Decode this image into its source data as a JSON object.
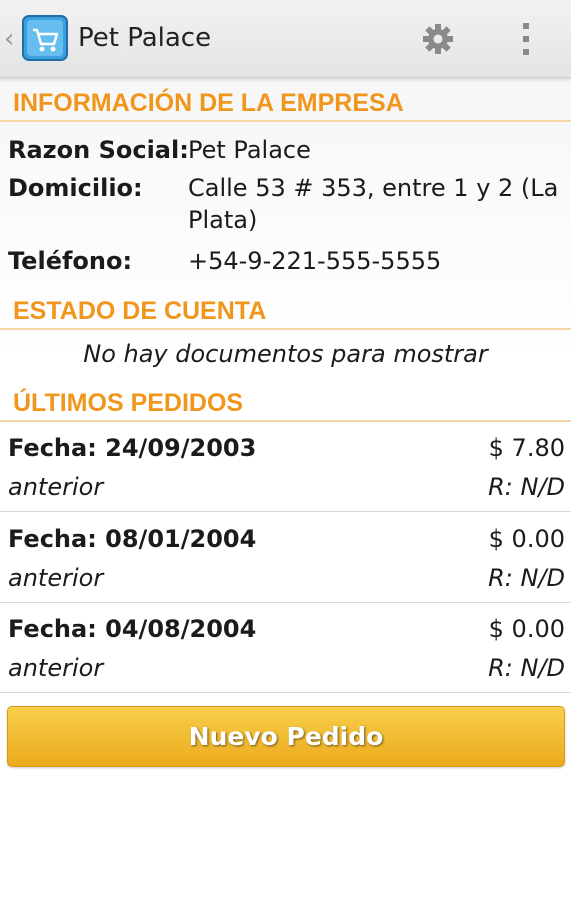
{
  "actionbar": {
    "title": "Pet Palace",
    "back_icon": "chevron-left-icon",
    "app_icon": "cart-icon",
    "settings_icon": "gear-icon",
    "overflow_icon": "more-vert-icon"
  },
  "company": {
    "header": "INFORMACIÓN DE LA EMPRESA",
    "rows": [
      {
        "label": "Razon Social:",
        "value": "Pet Palace"
      },
      {
        "label": "Domicilio:",
        "value": "Calle 53 # 353, entre 1 y 2 (La Plata)"
      },
      {
        "label": "Teléfono:",
        "value": "+54-9-221-555-5555"
      }
    ]
  },
  "account": {
    "header": "ESTADO DE CUENTA",
    "empty_message": "No hay documentos para mostrar"
  },
  "orders": {
    "header": "ÚLTIMOS PEDIDOS",
    "items": [
      {
        "date": "Fecha: 24/09/2003",
        "amount": "$ 7.80",
        "status": "anterior",
        "ref": "R: N/D"
      },
      {
        "date": "Fecha: 08/01/2004",
        "amount": "$ 0.00",
        "status": "anterior",
        "ref": "R: N/D"
      },
      {
        "date": "Fecha: 04/08/2004",
        "amount": "$ 0.00",
        "status": "anterior",
        "ref": "R: N/D"
      }
    ]
  },
  "new_order_button": "Nuevo Pedido",
  "colors": {
    "accent": "#f0961c",
    "button_top": "#f8cf4b",
    "button_bottom": "#ecaa1c",
    "app_icon": "#3aa0e0"
  }
}
